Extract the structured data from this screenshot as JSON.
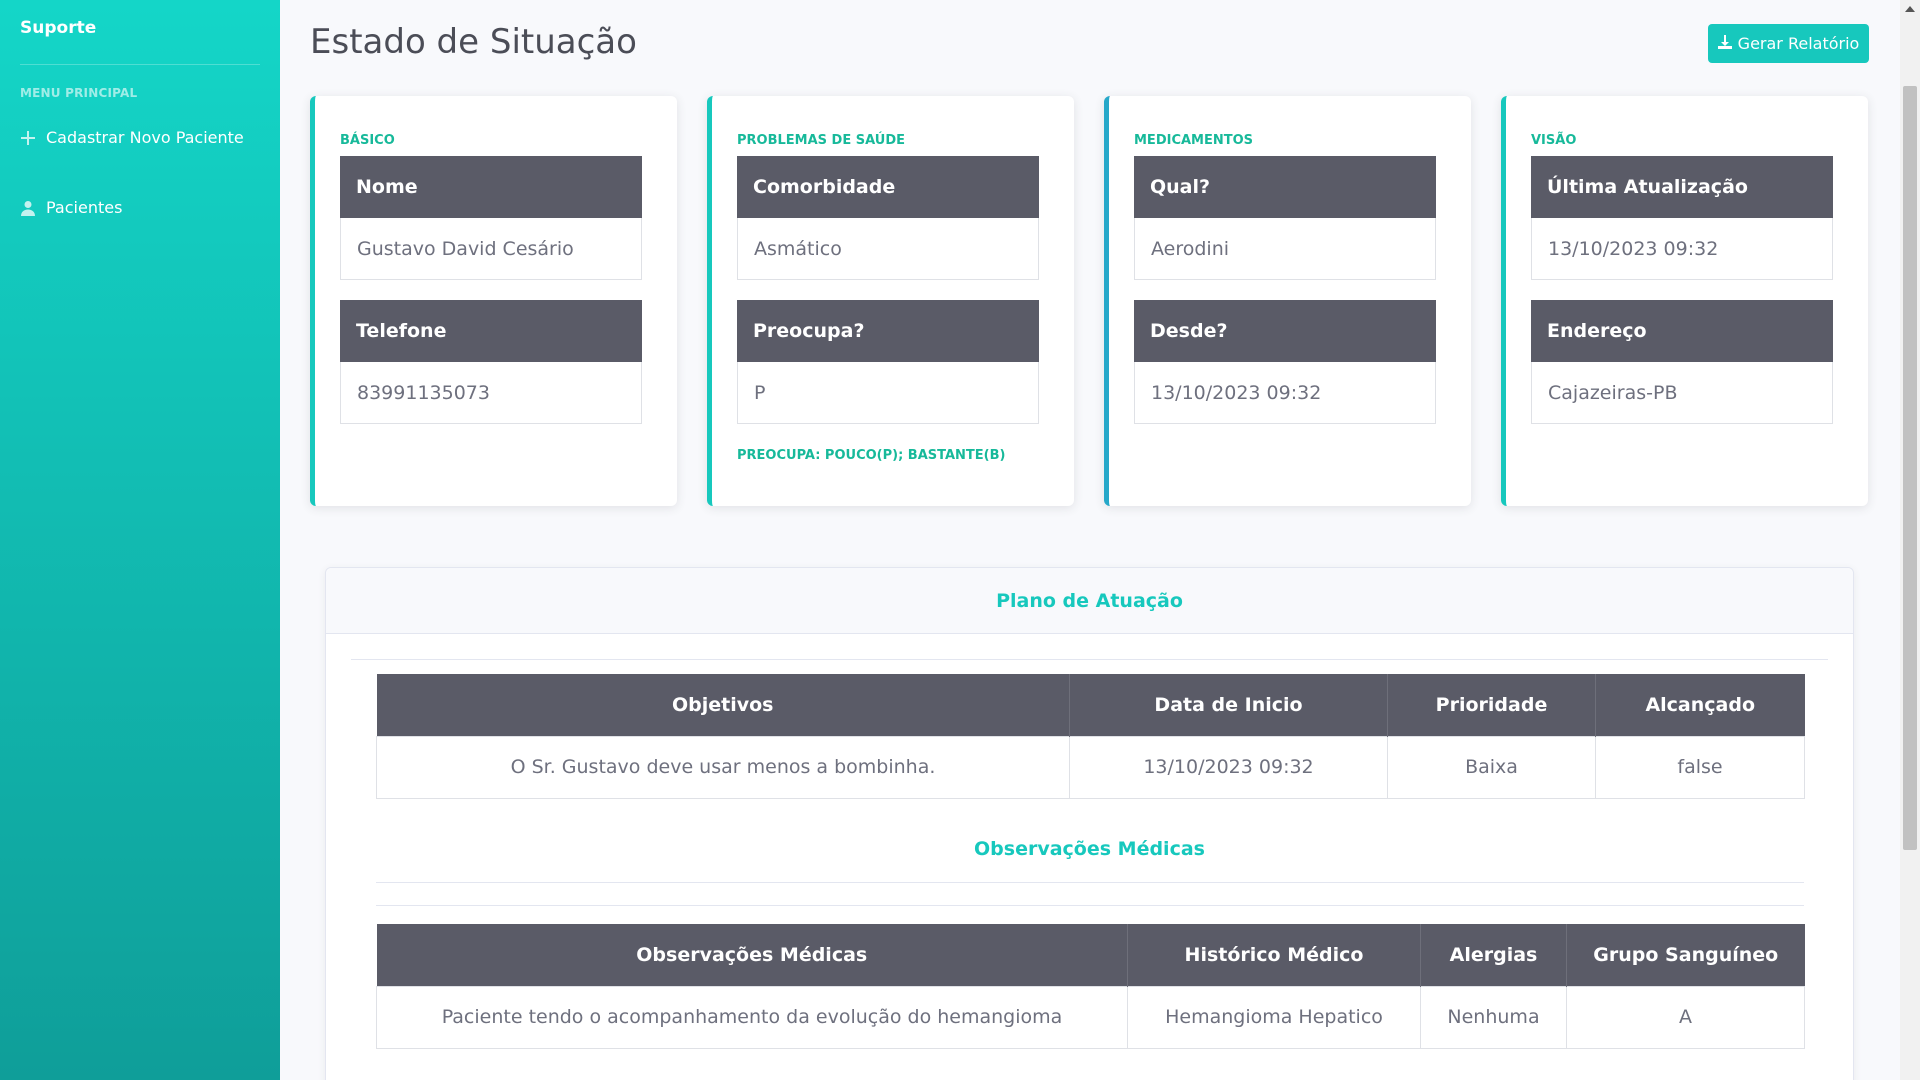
{
  "sidebar": {
    "brand": "Suporte",
    "heading": "MENU PRINCIPAL",
    "items": [
      {
        "label": "Cadastrar Novo Paciente",
        "icon": "plus-icon"
      },
      {
        "label": "Pacientes",
        "icon": "user-icon"
      }
    ]
  },
  "header": {
    "title": "Estado de Situação",
    "report_button": "Gerar Relatório",
    "report_icon": "download-icon"
  },
  "cards": [
    {
      "label": "BÁSICO",
      "fields": [
        {
          "name": "Nome",
          "value": "Gustavo David Cesário"
        },
        {
          "name": "Telefone",
          "value": "83991135073"
        }
      ],
      "note": ""
    },
    {
      "label": "PROBLEMAS DE SAÚDE",
      "fields": [
        {
          "name": "Comorbidade",
          "value": "Asmático"
        },
        {
          "name": "Preocupa?",
          "value": "P"
        }
      ],
      "note": "PREOCUPA: POUCO(P); BASTANTE(B)"
    },
    {
      "label": "MEDICAMENTOS",
      "fields": [
        {
          "name": "Qual?",
          "value": "Aerodini"
        },
        {
          "name": "Desde?",
          "value": "13/10/2023 09:32"
        }
      ],
      "note": ""
    },
    {
      "label": "VISÃO",
      "fields": [
        {
          "name": "Última Atualização",
          "value": "13/10/2023 09:32"
        },
        {
          "name": "Endereço",
          "value": "Cajazeiras-PB"
        }
      ],
      "note": ""
    }
  ],
  "plan": {
    "title": "Plano de Atuação",
    "table": {
      "headers": [
        "Objetivos",
        "Data de Inicio",
        "Prioridade",
        "Alcançado"
      ],
      "rows": [
        [
          "O Sr. Gustavo deve usar menos a bombinha.",
          "13/10/2023 09:32",
          "Baixa",
          "false"
        ]
      ]
    },
    "observations_title": "Observações Médicas",
    "observations_table": {
      "headers": [
        "Observações Médicas",
        "Histórico Médico",
        "Alergias",
        "Grupo Sanguíneo"
      ],
      "rows": [
        [
          "Paciente tendo o acompanhamento da evolução do hemangioma",
          "Hemangioma Hepatico",
          "Nenhuma",
          "A"
        ]
      ]
    }
  },
  "colors": {
    "accent": "#17c8bd",
    "label_green": "#17b99a",
    "header_dark": "#5a5b67",
    "sidebar_top": "#14d6c8",
    "sidebar_bottom": "#0f9e99"
  }
}
